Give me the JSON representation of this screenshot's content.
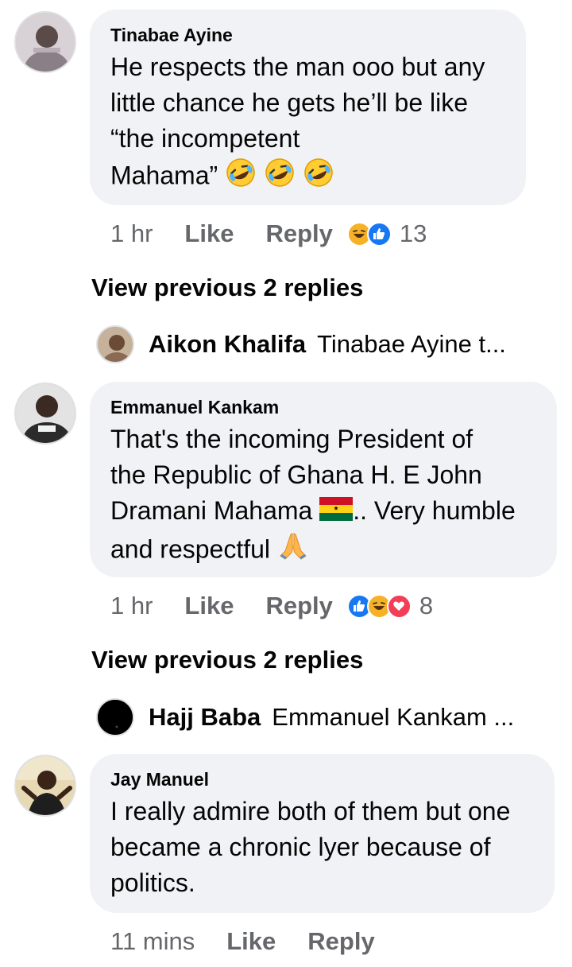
{
  "comments": [
    {
      "author": "Tinabae Ayine",
      "lines": [
        "He respects the man ooo but any",
        "little chance he gets he’ll be like",
        "“the incompetent",
        "Mahama”"
      ],
      "emoji_tail": [
        "rofl-emoji",
        "rofl-emoji",
        "rofl-emoji"
      ],
      "time": "1 hr",
      "like_label": "Like",
      "reply_label": "Reply",
      "reactions": [
        "haha",
        "like"
      ],
      "reaction_count": "13",
      "view_previous": "View previous 2 replies",
      "latest_reply": {
        "name": "Aikon Khalifa",
        "snippet": "Tinabae Ayine t..."
      }
    },
    {
      "author": "Emmanuel Kankam",
      "lines": [
        "That's the incoming President of",
        "the Republic of Ghana H. E John",
        "Dramani Mahama",
        ".. Very humble",
        "and respectful"
      ],
      "time": "1 hr",
      "like_label": "Like",
      "reply_label": "Reply",
      "reactions": [
        "like",
        "haha",
        "love"
      ],
      "reaction_count": "8",
      "view_previous": "View previous 2 replies",
      "latest_reply": {
        "name": "Hajj Baba",
        "snippet": "Emmanuel Kankam ..."
      }
    },
    {
      "author": "Jay Manuel",
      "lines": [
        "I really admire both of them but one",
        "became a chronic lyer because of",
        "politics."
      ],
      "time": "11 mins",
      "like_label": "Like",
      "reply_label": "Reply"
    }
  ],
  "colors": {
    "bubble": "#f0f2f5",
    "meta_text": "#65676b",
    "like_blue": "#1877f2",
    "haha_yellow": "#f7b125",
    "love_red": "#f33e58"
  }
}
